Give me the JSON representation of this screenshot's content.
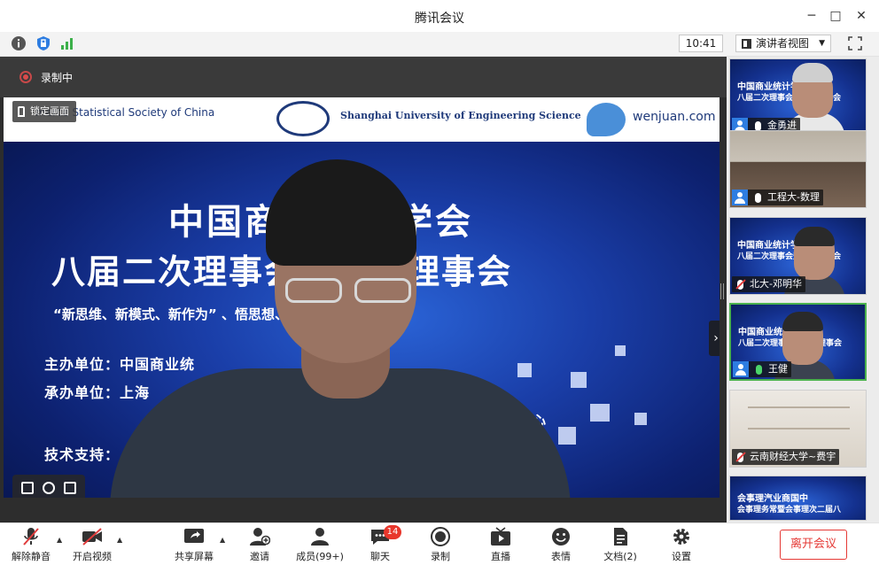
{
  "window": {
    "title": "腾讯会议",
    "minimize": "─",
    "maximize": "□",
    "close": "✕"
  },
  "toolbar": {
    "icons": [
      "info-icon",
      "shield-icon",
      "signal-icon"
    ],
    "clock": "10:41",
    "view_mode": "演讲者视图",
    "view_caret": "▼",
    "fullscreen_icon": "fullscreen-icon"
  },
  "recording": {
    "label": "录制中"
  },
  "video": {
    "lock_label": "锁定画面",
    "next_arrow": "›",
    "slide": {
      "header_left": "merce Statistical Society of China",
      "header_mid": "Shanghai University of Engineering Science",
      "header_right": "wenjuan.com",
      "line1": "中国商业统计学会",
      "line2": "八届二次理事会暨常务理事会",
      "line3": "“新思维、新模式、新作为” 、悟思想、担使命” 主题报告",
      "host": "主办单位：中国商业统",
      "organizer": "承办单位：上海",
      "organizer2": "上",
      "organizer_tail": "心",
      "support": "技术支持："
    }
  },
  "gallery": {
    "participants": [
      {
        "name": "金勇进",
        "kind": "slide",
        "mic": "on",
        "active": false
      },
      {
        "name": "工程大-数理",
        "kind": "room",
        "mic": "on",
        "active": false
      },
      {
        "name": "北大-邓明华",
        "kind": "slide",
        "mic": "muted",
        "active": false
      },
      {
        "name": "王健",
        "kind": "slide",
        "mic": "speaking",
        "active": true
      },
      {
        "name": "云南财经大学~费宇",
        "kind": "shelf",
        "mic": "muted",
        "active": false
      },
      {
        "name": "",
        "kind": "slide",
        "mic": "none",
        "active": false
      }
    ],
    "slide_line1": "中国商业统计学会",
    "slide_line2": "八届二次理事会暨常务理事会",
    "slide_flipped1": "会事理汽业商国中",
    "slide_flipped2": "会事理务常暨会事理次二届八"
  },
  "bottombar": {
    "items": [
      {
        "label": "解除静音",
        "icon": "mic-muted-icon"
      },
      {
        "label": "开启视频",
        "icon": "camera-off-icon"
      },
      {
        "label": "共享屏幕",
        "icon": "share-screen-icon"
      },
      {
        "label": "邀请",
        "icon": "invite-icon"
      },
      {
        "label": "成员(99+)",
        "icon": "members-icon"
      },
      {
        "label": "聊天",
        "icon": "chat-icon"
      },
      {
        "label": "录制",
        "icon": "record-icon"
      },
      {
        "label": "直播",
        "icon": "live-icon"
      },
      {
        "label": "表情",
        "icon": "emoji-icon"
      },
      {
        "label": "文档(2)",
        "icon": "document-icon"
      },
      {
        "label": "设置",
        "icon": "settings-icon"
      }
    ],
    "chat_badge": "14",
    "caret": "▲",
    "leave": "离开会议"
  },
  "colors": {
    "accent": "#2e7de1",
    "danger": "#e53935",
    "speaking": "#4bb24e"
  }
}
